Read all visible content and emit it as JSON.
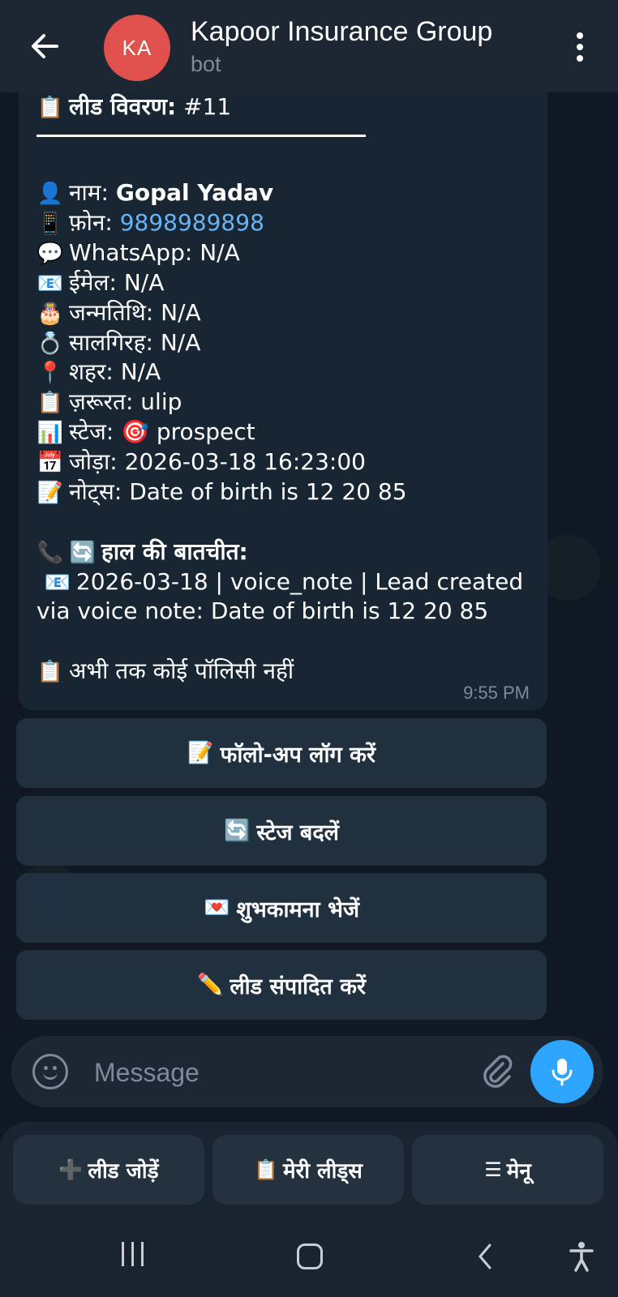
{
  "header": {
    "avatar_initials": "KA",
    "title": "Kapoor Insurance Group",
    "subtitle": "bot",
    "back_icon": "back-arrow-icon",
    "menu_icon": "more-vertical-icon"
  },
  "message": {
    "title_label": "लीड विवरण:",
    "title_value": "#11",
    "fields": [
      {
        "icon": "👤",
        "label": "नाम:",
        "value": "Gopal Yadav"
      },
      {
        "icon": "📱",
        "label": "फ़ोन:",
        "value": "9898989898"
      },
      {
        "icon": "💬",
        "label": "WhatsApp:",
        "value": "N/A"
      },
      {
        "icon": "📧",
        "label": "ईमेल:",
        "value": "N/A"
      },
      {
        "icon": "🎂",
        "label": "जन्मतिथि:",
        "value": "N/A"
      },
      {
        "icon": "💍",
        "label": "सालगिरह:",
        "value": "N/A"
      },
      {
        "icon": "📍",
        "label": "शहर:",
        "value": "N/A"
      },
      {
        "icon": "📋",
        "label": "ज़रूरत:",
        "value": "ulip"
      },
      {
        "icon": "📊",
        "label": "स्टेज:",
        "value": "🎯 prospect"
      },
      {
        "icon": "📅",
        "label": "जोड़ा:",
        "value": "2026-03-18 16:23:00"
      },
      {
        "icon": "📝",
        "label": "नोट्स:",
        "value": "Date of birth is 12 20 85"
      }
    ],
    "recent_heading": "हाल की बातचीत:",
    "recent_line1": "2026-03-18 | voice_note | Lead created",
    "recent_line2": "via voice note: Date of birth is 12 20 85",
    "no_policy": "अभी तक कोई पॉलिसी नहीं",
    "time": "9:55 PM"
  },
  "inline_buttons": [
    {
      "icon": "📝",
      "label": "फॉलो-अप लॉग करें"
    },
    {
      "icon": "🔄",
      "label": "स्टेज बदलें"
    },
    {
      "icon": "💌",
      "label": "शुभकामना भेजें"
    },
    {
      "icon": "✏️",
      "label": "लीड संपादित करें"
    }
  ],
  "composer": {
    "placeholder": "Message"
  },
  "reply_keyboard": [
    {
      "icon": "➕",
      "label": "लीड जोड़ें"
    },
    {
      "icon": "📋",
      "label": "मेरी लीड्स"
    },
    {
      "icon": "☰",
      "label": "मेनू"
    }
  ],
  "colors": {
    "accent": "#2ea6ff",
    "link": "#6ab3f3",
    "avatar": "#e0504d"
  }
}
